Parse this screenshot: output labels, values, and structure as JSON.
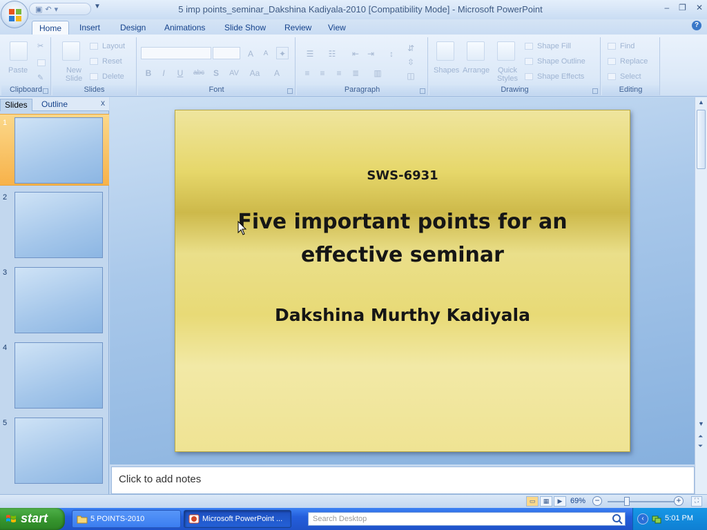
{
  "window": {
    "title": "5 imp points_seminar_Dakshina Kadiyala-2010 [Compatibility Mode] - Microsoft PowerPoint",
    "minimize": "–",
    "restore": "❐",
    "close": "✕"
  },
  "ribbon_tabs": [
    {
      "label": "Home",
      "active": true
    },
    {
      "label": "Insert"
    },
    {
      "label": "Design"
    },
    {
      "label": "Animations"
    },
    {
      "label": "Slide Show"
    },
    {
      "label": "Review"
    },
    {
      "label": "View"
    }
  ],
  "ribbon": {
    "clipboard": {
      "label": "Clipboard",
      "paste": "Paste"
    },
    "slides": {
      "label": "Slides",
      "new_slide": "New Slide",
      "layout": "Layout",
      "reset": "Reset",
      "delete": "Delete"
    },
    "font": {
      "label": "Font",
      "bold": "B",
      "italic": "I",
      "underline": "U",
      "strike": "abc",
      "shadow": "S",
      "spacing": "AV",
      "case": "Aa",
      "color": "A",
      "grow": "A",
      "shrink": "A"
    },
    "paragraph": {
      "label": "Paragraph"
    },
    "drawing": {
      "label": "Drawing",
      "shapes": "Shapes",
      "arrange": "Arrange",
      "quick_styles": "Quick Styles",
      "shape_fill": "Shape Fill",
      "shape_outline": "Shape Outline",
      "shape_effects": "Shape Effects"
    },
    "editing": {
      "label": "Editing",
      "find": "Find",
      "replace": "Replace",
      "select": "Select"
    }
  },
  "left_panel": {
    "tabs": [
      {
        "label": "Slides",
        "active": true
      },
      {
        "label": "Outline"
      }
    ],
    "close": "x",
    "thumbnails": [
      {
        "number": "1",
        "selected": true
      },
      {
        "number": "2"
      },
      {
        "number": "3"
      },
      {
        "number": "4"
      },
      {
        "number": "5"
      }
    ]
  },
  "slide": {
    "code": "SWS-6931",
    "title": "Five important points for an effective seminar",
    "author": "Dakshina Murthy Kadiyala"
  },
  "notes": {
    "placeholder": "Click to add notes"
  },
  "status_bar": {
    "zoom": "69%"
  },
  "taskbar": {
    "start": "start",
    "items": [
      {
        "label": "5 POINTS-2010",
        "active": false
      },
      {
        "label": "Microsoft PowerPoint ...",
        "active": true
      }
    ],
    "search_placeholder": "Search Desktop",
    "clock": "5:01 PM"
  },
  "colors": {
    "ribbon_bg": "#dce9f8",
    "slide_gold": "#e6d76a",
    "selected_thumb": "#f7b24a",
    "taskbar_blue": "#245edc",
    "start_green": "#37962f"
  }
}
